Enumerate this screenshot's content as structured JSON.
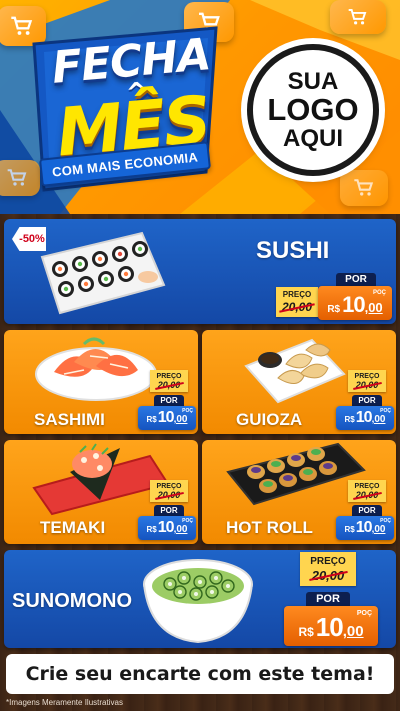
{
  "header": {
    "title_line1": "FECHA",
    "title_line2": "MÊS",
    "subtitle": "COM MAIS ECONOMIA",
    "logo_line1": "SUA",
    "logo_line2": "LOGO",
    "logo_line3": "AQUI"
  },
  "colors": {
    "header_orange": "#ff9800",
    "card_blue": "#1a56b8",
    "card_orange": "#f7970c",
    "price_yellow": "#ffd54f",
    "title_yellow": "#ffe600"
  },
  "labels": {
    "price_label": "PREÇO",
    "por_label": "POR",
    "currency": "R$",
    "poc_label": "POÇ"
  },
  "products": [
    {
      "name": "SUSHI",
      "discount": "-50%",
      "old_price": "20,00",
      "new_int": "10",
      "new_dec": ",00",
      "image": "sushi-tray"
    },
    {
      "name": "SASHIMI",
      "old_price": "20,00",
      "new_int": "10",
      "new_dec": ",00",
      "image": "salmon-sashimi"
    },
    {
      "name": "GUIOZA",
      "old_price": "20,00",
      "new_int": "10",
      "new_dec": ",00",
      "image": "gyoza-plate"
    },
    {
      "name": "TEMAKI",
      "old_price": "20,00",
      "new_int": "10",
      "new_dec": ",00",
      "image": "temaki-cone"
    },
    {
      "name": "HOT ROLL",
      "old_price": "20,00",
      "new_int": "10",
      "new_dec": ",00",
      "image": "hot-roll-tray"
    },
    {
      "name": "SUNOMONO",
      "old_price": "20,00",
      "new_int": "10",
      "new_dec": ",00",
      "image": "cucumber-salad"
    }
  ],
  "footer": {
    "cta": "Crie seu encarte com este tema!",
    "disclaimer": "*Imagens Meramente Ilustrativas"
  }
}
